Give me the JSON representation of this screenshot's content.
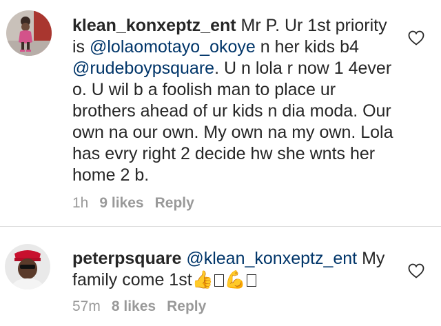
{
  "comments": [
    {
      "username": "klean_konxeptz_ent",
      "text_1": " Mr P. Ur 1st priority is ",
      "mention_1": "@lolaomotayo_okoye",
      "text_2": " n her kids b4 ",
      "mention_2": "@rudeboypsquare",
      "text_3": ". U n lola r now 1 4ever o. U wil b a foolish man to place ur brothers ahead of ur kids n dia moda. Our own na our own. My own na my own. Lola has evry right 2 decide hw she wnts her home 2 b.",
      "time": "1h",
      "likes": "9 likes",
      "reply": "Reply",
      "avatar_icon": "girl-avatar",
      "like_icon": "heart-outline-icon"
    },
    {
      "username": "peterpsquare",
      "mention_1": "@klean_konxeptz_ent",
      "text_1": " My family come 1st",
      "emoji_1": "👍",
      "emoji_2": "💪",
      "time": "57m",
      "likes": "8 likes",
      "reply": "Reply",
      "avatar_icon": "man-avatar",
      "like_icon": "heart-outline-icon"
    }
  ],
  "colors": {
    "text": "#262626",
    "mention": "#003569",
    "meta": "#999999",
    "divider": "#dbdbdb",
    "emoji_pink": "#e0338f"
  }
}
